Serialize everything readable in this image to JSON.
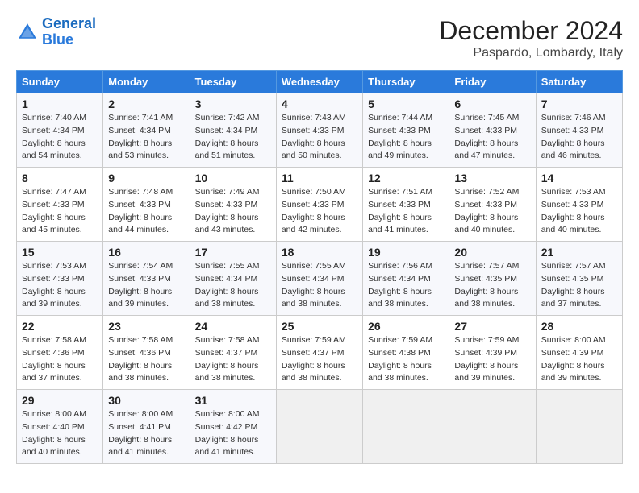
{
  "header": {
    "logo_line1": "General",
    "logo_line2": "Blue",
    "month": "December 2024",
    "location": "Paspardo, Lombardy, Italy"
  },
  "weekdays": [
    "Sunday",
    "Monday",
    "Tuesday",
    "Wednesday",
    "Thursday",
    "Friday",
    "Saturday"
  ],
  "weeks": [
    [
      {
        "day": "1",
        "sunrise": "Sunrise: 7:40 AM",
        "sunset": "Sunset: 4:34 PM",
        "daylight": "Daylight: 8 hours and 54 minutes."
      },
      {
        "day": "2",
        "sunrise": "Sunrise: 7:41 AM",
        "sunset": "Sunset: 4:34 PM",
        "daylight": "Daylight: 8 hours and 53 minutes."
      },
      {
        "day": "3",
        "sunrise": "Sunrise: 7:42 AM",
        "sunset": "Sunset: 4:34 PM",
        "daylight": "Daylight: 8 hours and 51 minutes."
      },
      {
        "day": "4",
        "sunrise": "Sunrise: 7:43 AM",
        "sunset": "Sunset: 4:33 PM",
        "daylight": "Daylight: 8 hours and 50 minutes."
      },
      {
        "day": "5",
        "sunrise": "Sunrise: 7:44 AM",
        "sunset": "Sunset: 4:33 PM",
        "daylight": "Daylight: 8 hours and 49 minutes."
      },
      {
        "day": "6",
        "sunrise": "Sunrise: 7:45 AM",
        "sunset": "Sunset: 4:33 PM",
        "daylight": "Daylight: 8 hours and 47 minutes."
      },
      {
        "day": "7",
        "sunrise": "Sunrise: 7:46 AM",
        "sunset": "Sunset: 4:33 PM",
        "daylight": "Daylight: 8 hours and 46 minutes."
      }
    ],
    [
      {
        "day": "8",
        "sunrise": "Sunrise: 7:47 AM",
        "sunset": "Sunset: 4:33 PM",
        "daylight": "Daylight: 8 hours and 45 minutes."
      },
      {
        "day": "9",
        "sunrise": "Sunrise: 7:48 AM",
        "sunset": "Sunset: 4:33 PM",
        "daylight": "Daylight: 8 hours and 44 minutes."
      },
      {
        "day": "10",
        "sunrise": "Sunrise: 7:49 AM",
        "sunset": "Sunset: 4:33 PM",
        "daylight": "Daylight: 8 hours and 43 minutes."
      },
      {
        "day": "11",
        "sunrise": "Sunrise: 7:50 AM",
        "sunset": "Sunset: 4:33 PM",
        "daylight": "Daylight: 8 hours and 42 minutes."
      },
      {
        "day": "12",
        "sunrise": "Sunrise: 7:51 AM",
        "sunset": "Sunset: 4:33 PM",
        "daylight": "Daylight: 8 hours and 41 minutes."
      },
      {
        "day": "13",
        "sunrise": "Sunrise: 7:52 AM",
        "sunset": "Sunset: 4:33 PM",
        "daylight": "Daylight: 8 hours and 40 minutes."
      },
      {
        "day": "14",
        "sunrise": "Sunrise: 7:53 AM",
        "sunset": "Sunset: 4:33 PM",
        "daylight": "Daylight: 8 hours and 40 minutes."
      }
    ],
    [
      {
        "day": "15",
        "sunrise": "Sunrise: 7:53 AM",
        "sunset": "Sunset: 4:33 PM",
        "daylight": "Daylight: 8 hours and 39 minutes."
      },
      {
        "day": "16",
        "sunrise": "Sunrise: 7:54 AM",
        "sunset": "Sunset: 4:33 PM",
        "daylight": "Daylight: 8 hours and 39 minutes."
      },
      {
        "day": "17",
        "sunrise": "Sunrise: 7:55 AM",
        "sunset": "Sunset: 4:34 PM",
        "daylight": "Daylight: 8 hours and 38 minutes."
      },
      {
        "day": "18",
        "sunrise": "Sunrise: 7:55 AM",
        "sunset": "Sunset: 4:34 PM",
        "daylight": "Daylight: 8 hours and 38 minutes."
      },
      {
        "day": "19",
        "sunrise": "Sunrise: 7:56 AM",
        "sunset": "Sunset: 4:34 PM",
        "daylight": "Daylight: 8 hours and 38 minutes."
      },
      {
        "day": "20",
        "sunrise": "Sunrise: 7:57 AM",
        "sunset": "Sunset: 4:35 PM",
        "daylight": "Daylight: 8 hours and 38 minutes."
      },
      {
        "day": "21",
        "sunrise": "Sunrise: 7:57 AM",
        "sunset": "Sunset: 4:35 PM",
        "daylight": "Daylight: 8 hours and 37 minutes."
      }
    ],
    [
      {
        "day": "22",
        "sunrise": "Sunrise: 7:58 AM",
        "sunset": "Sunset: 4:36 PM",
        "daylight": "Daylight: 8 hours and 37 minutes."
      },
      {
        "day": "23",
        "sunrise": "Sunrise: 7:58 AM",
        "sunset": "Sunset: 4:36 PM",
        "daylight": "Daylight: 8 hours and 38 minutes."
      },
      {
        "day": "24",
        "sunrise": "Sunrise: 7:58 AM",
        "sunset": "Sunset: 4:37 PM",
        "daylight": "Daylight: 8 hours and 38 minutes."
      },
      {
        "day": "25",
        "sunrise": "Sunrise: 7:59 AM",
        "sunset": "Sunset: 4:37 PM",
        "daylight": "Daylight: 8 hours and 38 minutes."
      },
      {
        "day": "26",
        "sunrise": "Sunrise: 7:59 AM",
        "sunset": "Sunset: 4:38 PM",
        "daylight": "Daylight: 8 hours and 38 minutes."
      },
      {
        "day": "27",
        "sunrise": "Sunrise: 7:59 AM",
        "sunset": "Sunset: 4:39 PM",
        "daylight": "Daylight: 8 hours and 39 minutes."
      },
      {
        "day": "28",
        "sunrise": "Sunrise: 8:00 AM",
        "sunset": "Sunset: 4:39 PM",
        "daylight": "Daylight: 8 hours and 39 minutes."
      }
    ],
    [
      {
        "day": "29",
        "sunrise": "Sunrise: 8:00 AM",
        "sunset": "Sunset: 4:40 PM",
        "daylight": "Daylight: 8 hours and 40 minutes."
      },
      {
        "day": "30",
        "sunrise": "Sunrise: 8:00 AM",
        "sunset": "Sunset: 4:41 PM",
        "daylight": "Daylight: 8 hours and 41 minutes."
      },
      {
        "day": "31",
        "sunrise": "Sunrise: 8:00 AM",
        "sunset": "Sunset: 4:42 PM",
        "daylight": "Daylight: 8 hours and 41 minutes."
      },
      null,
      null,
      null,
      null
    ]
  ]
}
